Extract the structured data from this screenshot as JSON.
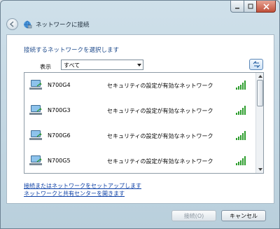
{
  "window": {
    "title": "ネットワークに接続"
  },
  "header": {
    "heading": "接続するネットワークを選択します"
  },
  "filter": {
    "label": "表示",
    "selected": "すべて"
  },
  "networks": [
    {
      "ssid": "N700G4",
      "security": "セキュリティの設定が有効なネットワーク",
      "signal_bars": 5
    },
    {
      "ssid": "N700G3",
      "security": "セキュリティの設定が有効なネットワーク",
      "signal_bars": 5
    },
    {
      "ssid": "N700G6",
      "security": "セキュリティの設定が有効なネットワーク",
      "signal_bars": 5
    },
    {
      "ssid": "N700G5",
      "security": "セキュリティの設定が有効なネットワーク",
      "signal_bars": 5
    }
  ],
  "links": {
    "setup": "接続またはネットワークをセットアップします",
    "center": "ネットワークと共有センターを開きます"
  },
  "buttons": {
    "connect": "接続(O)",
    "cancel": "キャンセル"
  },
  "colors": {
    "accent": "#1f4b8c",
    "link": "#0b3fa6",
    "signal": "#2c9d2c"
  }
}
